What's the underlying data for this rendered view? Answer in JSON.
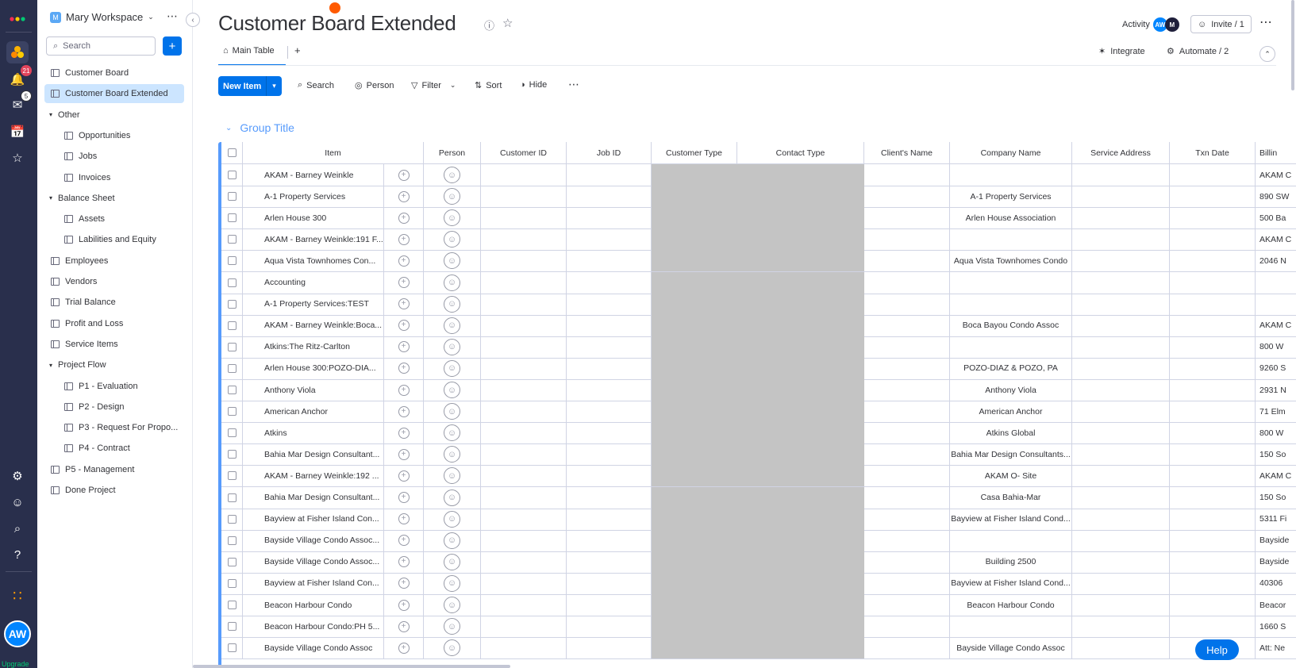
{
  "rail": {
    "notif_count": "21",
    "inbox_count": "5",
    "avatar": "AW",
    "upgrade": "Upgrade"
  },
  "sidebar": {
    "workspace_initial": "M",
    "workspace_name": "Mary Workspace",
    "search_placeholder": "Search",
    "items": [
      {
        "label": "Customer Board",
        "type": "board",
        "level": 0
      },
      {
        "label": "Customer Board Extended",
        "type": "board",
        "level": 0,
        "active": true
      },
      {
        "label": "Other",
        "type": "folder",
        "level": 0
      },
      {
        "label": "Opportunities",
        "type": "board",
        "level": 1
      },
      {
        "label": "Jobs",
        "type": "board",
        "level": 1
      },
      {
        "label": "Invoices",
        "type": "board",
        "level": 1
      },
      {
        "label": "Balance Sheet",
        "type": "folder",
        "level": 0
      },
      {
        "label": "Assets",
        "type": "board",
        "level": 1
      },
      {
        "label": "Labilities and Equity",
        "type": "board",
        "level": 1
      },
      {
        "label": "Employees",
        "type": "board",
        "level": 0
      },
      {
        "label": "Vendors",
        "type": "board",
        "level": 0
      },
      {
        "label": "Trial Balance",
        "type": "board",
        "level": 0
      },
      {
        "label": "Profit and Loss",
        "type": "board",
        "level": 0
      },
      {
        "label": "Service Items",
        "type": "board",
        "level": 0
      },
      {
        "label": "Project Flow",
        "type": "folder",
        "level": 0
      },
      {
        "label": "P1 - Evaluation",
        "type": "board",
        "level": 1
      },
      {
        "label": "P2 - Design",
        "type": "board",
        "level": 1
      },
      {
        "label": "P3 - Request For Propo...",
        "type": "board",
        "level": 1
      },
      {
        "label": "P4 - Contract",
        "type": "board",
        "level": 1
      },
      {
        "label": "P5 - Management",
        "type": "board",
        "level": 0
      },
      {
        "label": "Done Project",
        "type": "board",
        "level": 0
      }
    ]
  },
  "header": {
    "title": "Customer Board Extended",
    "activity": "Activity",
    "activity_av1": "AW",
    "activity_av2": "M",
    "invite": "Invite / 1",
    "main_tab": "Main Table",
    "add_tab": "+",
    "integrate": "Integrate",
    "automate": "Automate / 2"
  },
  "toolbar": {
    "new_item": "New Item",
    "search": "Search",
    "person": "Person",
    "filter": "Filter",
    "sort": "Sort",
    "hide": "Hide"
  },
  "group": {
    "title": "Group Title",
    "color": "#579bfc"
  },
  "columns": [
    "Item",
    "Person",
    "Customer ID",
    "Job ID",
    "Customer Type",
    "Contact Type",
    "Client's Name",
    "Company Name",
    "Service Address",
    "Txn Date",
    "Billin"
  ],
  "rows": [
    {
      "item": "AKAM - Barney Weinkle",
      "company": "",
      "billing": "AKAM C"
    },
    {
      "item": "A-1 Property Services",
      "company": "A-1 Property Services",
      "billing": "890 SW"
    },
    {
      "item": "Arlen House 300",
      "company": "Arlen House Association",
      "billing": "500 Ba"
    },
    {
      "item": "AKAM - Barney Weinkle:191 F...",
      "company": "",
      "billing": "AKAM C"
    },
    {
      "item": "Aqua Vista Townhomes Con...",
      "company": "Aqua Vista Townhomes Condo",
      "billing": "2046 N"
    },
    {
      "item": "Accounting",
      "company": "",
      "billing": ""
    },
    {
      "item": "A-1 Property Services:TEST",
      "company": "",
      "billing": ""
    },
    {
      "item": "AKAM - Barney Weinkle:Boca...",
      "company": "Boca Bayou Condo Assoc",
      "billing": "AKAM C"
    },
    {
      "item": "Atkins:The Ritz-Carlton",
      "company": "",
      "billing": "800 W"
    },
    {
      "item": "Arlen House 300:POZO-DIA...",
      "company": "POZO-DIAZ & POZO, PA",
      "billing": "9260 S"
    },
    {
      "item": "Anthony Viola",
      "company": "Anthony Viola",
      "billing": "2931 N"
    },
    {
      "item": "American Anchor",
      "company": "American Anchor",
      "billing": "71 Elm"
    },
    {
      "item": "Atkins",
      "company": "Atkins Global",
      "billing": "800 W"
    },
    {
      "item": "Bahia Mar Design Consultant...",
      "company": "Bahia Mar Design Consultants...",
      "billing": "150 So"
    },
    {
      "item": "AKAM - Barney Weinkle:192 ...",
      "company": "AKAM O- Site",
      "billing": "AKAM C"
    },
    {
      "item": "Bahia Mar Design Consultant...",
      "company": "Casa Bahia-Mar",
      "billing": "150 So"
    },
    {
      "item": "Bayview at Fisher Island Con...",
      "company": "Bayview at Fisher Island Cond...",
      "billing": "5311 Fi"
    },
    {
      "item": "Bayside Village Condo Assoc...",
      "company": "",
      "billing": "Bayside"
    },
    {
      "item": "Bayside Village Condo Assoc...",
      "company": "Building 2500",
      "billing": "Bayside"
    },
    {
      "item": "Bayview at Fisher Island Con...",
      "company": "Bayview at Fisher Island Cond...",
      "billing": "40306"
    },
    {
      "item": "Beacon Harbour Condo",
      "company": "Beacon Harbour Condo",
      "billing": "Beacor"
    },
    {
      "item": "Beacon Harbour Condo:PH 5...",
      "company": "",
      "billing": "1660 S"
    },
    {
      "item": "Bayside Village Condo Assoc",
      "company": "Bayside Village Condo Assoc",
      "billing": "Att: Ne"
    }
  ],
  "help": "Help"
}
